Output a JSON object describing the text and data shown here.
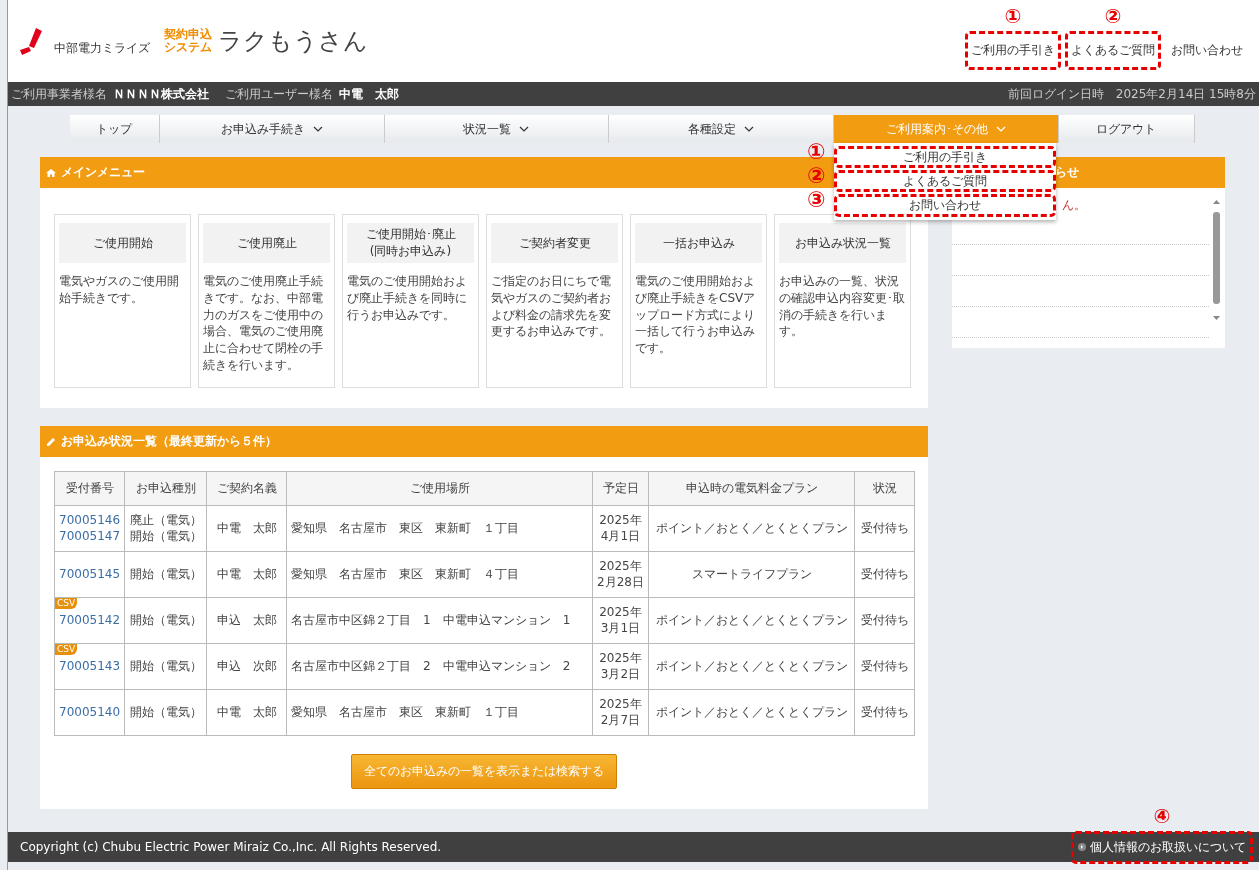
{
  "header": {
    "company": "中部電力ミライズ",
    "system_label": [
      "契約申込",
      "システム"
    ],
    "app_name": "ラクもうさん",
    "links": [
      {
        "label": "ご利用の手引き",
        "annotation": "①"
      },
      {
        "label": "よくあるご質問",
        "annotation": "②"
      },
      {
        "label": "お問い合わせ"
      }
    ]
  },
  "user_bar": {
    "company_label": "ご利用事業者様名",
    "company": "ＮＮＮＮ株式会社",
    "user_label": "ご利用ユーザー様名",
    "user": "中電　太郎",
    "last_login": "前回ログイン日時　2025年2月14日 15時8分"
  },
  "nav": [
    {
      "label": "トップ",
      "dropdown": false,
      "selected": false
    },
    {
      "label": "お申込み手続き",
      "dropdown": true,
      "selected": false
    },
    {
      "label": "状況一覧",
      "dropdown": true,
      "selected": false
    },
    {
      "label": "各種設定",
      "dropdown": true,
      "selected": false
    },
    {
      "label": "ご利用案内･その他",
      "dropdown": true,
      "selected": true
    },
    {
      "label": "ログアウト",
      "dropdown": false,
      "selected": false
    }
  ],
  "dropdown_menu": [
    {
      "label": "ご利用の手引き",
      "annotation": "①"
    },
    {
      "label": "よくあるご質問",
      "annotation": "②"
    },
    {
      "label": "お問い合わせ",
      "annotation": "③"
    }
  ],
  "main_menu": {
    "title": "メインメニュー",
    "cards": [
      {
        "title": "ご使用開始",
        "description": "電気やガスのご使用開始手続きです。"
      },
      {
        "title": "ご使用廃止",
        "description": "電気のご使用廃止手続きです。なお、中部電力のガスをご使用中の場合、電気のご使用廃止に合わせて閉栓の手続きを行います。"
      },
      {
        "title": "ご使用開始･廃止\n(同時お申込み)",
        "description": "電気のご使用開始および廃止手続きを同時に行うお申込みです。"
      },
      {
        "title": "ご契約者変更",
        "description": "ご指定のお日にちで電気やガスのご契約者および料金の請求先を変更するお申込みです。"
      },
      {
        "title": "一括お申込み",
        "description": "電気のご使用開始および廃止手続きをCSVアップロード方式により一括して行うお申込みです。"
      },
      {
        "title": "お申込み状況一覧",
        "description": "お申込みの一覧、状況の確認申込内容変更･取消の手続きを行います。"
      }
    ]
  },
  "notice_panel": {
    "title_fragment": "らせ",
    "message_fragment": "ん。"
  },
  "applications": {
    "title": "お申込み状況一覧（最終更新から５件）",
    "columns": [
      "受付番号",
      "お申込種別",
      "ご契約名義",
      "ご使用場所",
      "予定日",
      "申込時の電気料金プラン",
      "状況"
    ],
    "rows": [
      {
        "numbers": [
          "70005146",
          "70005147"
        ],
        "types": [
          "廃止（電気）",
          "開始（電気）"
        ],
        "name": "中電　太郎",
        "place": "愛知県　名古屋市　東区　東新町　１丁目",
        "date": "2025年\n4月1日",
        "plan": "ポイント／おとく／とくとくプラン",
        "status": "受付待ち"
      },
      {
        "numbers": [
          "70005145"
        ],
        "types": [
          "開始（電気）"
        ],
        "name": "中電　太郎",
        "place": "愛知県　名古屋市　東区　東新町　４丁目",
        "date": "2025年\n2月28日",
        "plan": "スマートライフプラン",
        "status": "受付待ち"
      },
      {
        "badge": "CSV",
        "numbers": [
          "70005142"
        ],
        "types": [
          "開始（電気）"
        ],
        "name": "申込　太郎",
        "place": "名古屋市中区錦２丁目　1　中電申込マンション　1",
        "date": "2025年\n3月1日",
        "plan": "ポイント／おとく／とくとくプラン",
        "status": "受付待ち"
      },
      {
        "badge": "CSV",
        "numbers": [
          "70005143"
        ],
        "types": [
          "開始（電気）"
        ],
        "name": "申込　次郎",
        "place": "名古屋市中区錦２丁目　2　中電申込マンション　2",
        "date": "2025年\n3月2日",
        "plan": "ポイント／おとく／とくとくプラン",
        "status": "受付待ち"
      },
      {
        "numbers": [
          "70005140"
        ],
        "types": [
          "開始（電気）"
        ],
        "name": "中電　太郎",
        "place": "愛知県　名古屋市　東区　東新町　１丁目",
        "date": "2025年\n2月7日",
        "plan": "ポイント／おとく／とくとくプラン",
        "status": "受付待ち"
      }
    ],
    "button": "全てのお申込みの一覧を表示または検索する"
  },
  "footer": {
    "copyright": "Copyright (c) Chubu Electric Power Miraiz Co.,Inc. All Rights Reserved.",
    "link": {
      "label": "個人情報のお取扱いについて",
      "annotation": "④"
    }
  }
}
